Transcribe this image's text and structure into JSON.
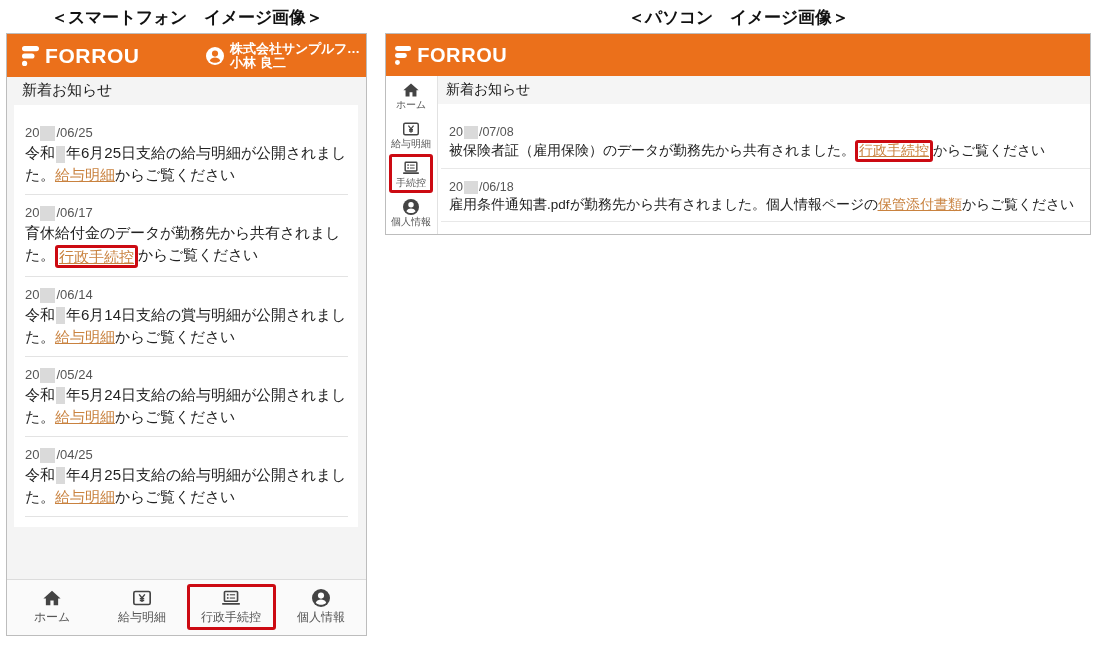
{
  "phone": {
    "caption": "＜スマートフォン　イメージ画像＞",
    "header": {
      "logo": "FORROU",
      "company": "株式会社サンプルフ…",
      "user": "小林 良二"
    },
    "section_title": "新着お知らせ",
    "notices": [
      {
        "date": [
          {
            "kind": "text",
            "text": "20"
          },
          {
            "kind": "redaction"
          },
          {
            "kind": "text",
            "text": "/06/25"
          }
        ],
        "message": [
          {
            "kind": "text",
            "text": "令和"
          },
          {
            "kind": "redaction"
          },
          {
            "kind": "text",
            "text": "年6月25日支給の給与明細が公開されました。"
          },
          {
            "kind": "link",
            "text": "給与明細",
            "highlighted": false
          },
          {
            "kind": "text",
            "text": "からご覧ください"
          }
        ]
      },
      {
        "date": [
          {
            "kind": "text",
            "text": "20"
          },
          {
            "kind": "redaction"
          },
          {
            "kind": "text",
            "text": "/06/17"
          }
        ],
        "message": [
          {
            "kind": "text",
            "text": "育休給付金のデータが勤務先から共有されました。"
          },
          {
            "kind": "link",
            "text": "行政手続控",
            "highlighted": true
          },
          {
            "kind": "text",
            "text": "からご覧ください"
          }
        ]
      },
      {
        "date": [
          {
            "kind": "text",
            "text": "20"
          },
          {
            "kind": "redaction"
          },
          {
            "kind": "text",
            "text": "/06/14"
          }
        ],
        "message": [
          {
            "kind": "text",
            "text": "令和"
          },
          {
            "kind": "redaction"
          },
          {
            "kind": "text",
            "text": "年6月14日支給の賞与明細が公開されました。"
          },
          {
            "kind": "link",
            "text": "給与明細",
            "highlighted": false
          },
          {
            "kind": "text",
            "text": "からご覧ください"
          }
        ]
      },
      {
        "date": [
          {
            "kind": "text",
            "text": "20"
          },
          {
            "kind": "redaction"
          },
          {
            "kind": "text",
            "text": "/05/24"
          }
        ],
        "message": [
          {
            "kind": "text",
            "text": "令和"
          },
          {
            "kind": "redaction"
          },
          {
            "kind": "text",
            "text": "年5月24日支給の給与明細が公開されました。"
          },
          {
            "kind": "link",
            "text": "給与明細",
            "highlighted": false
          },
          {
            "kind": "text",
            "text": "からご覧ください"
          }
        ]
      },
      {
        "date": [
          {
            "kind": "text",
            "text": "20"
          },
          {
            "kind": "redaction"
          },
          {
            "kind": "text",
            "text": "/04/25"
          }
        ],
        "message": [
          {
            "kind": "text",
            "text": "令和"
          },
          {
            "kind": "redaction"
          },
          {
            "kind": "text",
            "text": "年4月25日支給の給与明細が公開されました。"
          },
          {
            "kind": "link",
            "text": "給与明細",
            "highlighted": false
          },
          {
            "kind": "text",
            "text": "からご覧ください"
          }
        ]
      }
    ],
    "nav": [
      {
        "kind": "home",
        "label": "ホーム",
        "highlighted": false
      },
      {
        "kind": "payslip",
        "label": "給与明細",
        "highlighted": false
      },
      {
        "kind": "procedures",
        "label": "行政手続控",
        "highlighted": true
      },
      {
        "kind": "profile",
        "label": "個人情報",
        "highlighted": false
      }
    ]
  },
  "pc": {
    "caption": "＜パソコン　イメージ画像＞",
    "header": {
      "logo": "FORROU"
    },
    "sidebar": [
      {
        "kind": "home",
        "label": "ホーム",
        "highlighted": false
      },
      {
        "kind": "payslip",
        "label": "給与明細",
        "highlighted": false
      },
      {
        "kind": "procedures",
        "label": "手続控",
        "highlighted": true
      },
      {
        "kind": "profile",
        "label": "個人情報",
        "highlighted": false
      }
    ],
    "section_title": "新着お知らせ",
    "notices": [
      {
        "date": [
          {
            "kind": "text",
            "text": "20"
          },
          {
            "kind": "redaction"
          },
          {
            "kind": "text",
            "text": "/07/08"
          }
        ],
        "message": [
          {
            "kind": "text",
            "text": "被保険者証（雇用保険）のデータが勤務先から共有されました。"
          },
          {
            "kind": "link",
            "text": "行政手続控",
            "highlighted": true
          },
          {
            "kind": "text",
            "text": "からご覧ください"
          }
        ]
      },
      {
        "date": [
          {
            "kind": "text",
            "text": "20"
          },
          {
            "kind": "redaction"
          },
          {
            "kind": "text",
            "text": "/06/18"
          }
        ],
        "message": [
          {
            "kind": "text",
            "text": "雇用条件通知書.pdfが勤務先から共有されました。個人情報ページの"
          },
          {
            "kind": "link",
            "text": "保管添付書類",
            "highlighted": false
          },
          {
            "kind": "text",
            "text": "からご覧ください"
          }
        ]
      }
    ]
  }
}
